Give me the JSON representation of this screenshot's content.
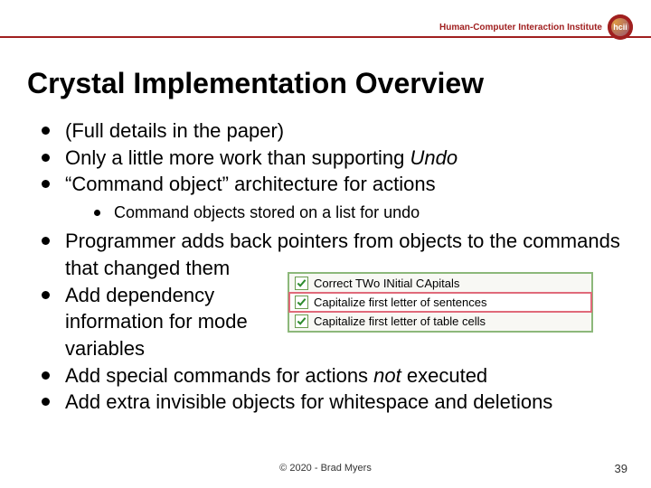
{
  "header": {
    "institute": "Human-Computer Interaction Institute",
    "logo_label": "hcii"
  },
  "title": "Crystal Implementation Overview",
  "bullets": {
    "b1": "(Full details in the paper)",
    "b2_pre": "Only a little more work than supporting ",
    "b2_em": "Undo",
    "b3": "“Command object” architecture for actions",
    "b3_sub1": "Command objects stored on a list for undo",
    "b4": "Programmer adds back pointers from objects to the commands that changed them",
    "b5": "Add dependency information for mode variables",
    "b6_pre": "Add special commands for actions ",
    "b6_em": "not",
    "b6_post": " executed",
    "b7": "Add extra invisible objects for whitespace and deletions"
  },
  "inset": {
    "row1": "Correct TWo INitial CApitals",
    "row2": "Capitalize first letter of sentences",
    "row3": "Capitalize first letter of table cells"
  },
  "footer": {
    "copyright": "© 2020 - Brad Myers",
    "page": "39"
  }
}
